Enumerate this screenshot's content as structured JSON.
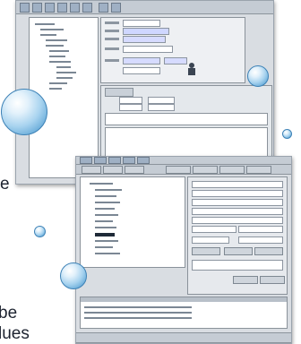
{
  "fragments": {
    "line1": "e",
    "line2": "be",
    "line3": "lues"
  },
  "top_window": {
    "status": "",
    "list_rows": 14
  },
  "bottom_window": {
    "list_rows": 9
  }
}
